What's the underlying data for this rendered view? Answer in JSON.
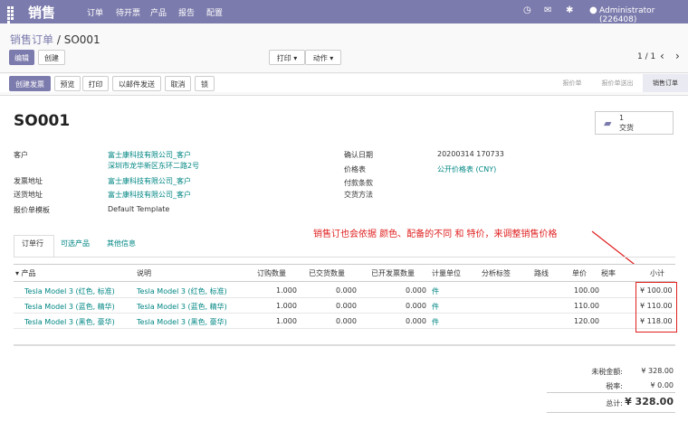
{
  "nav": {
    "app_title": "销售",
    "menu": [
      "订单",
      "待开票",
      "产品",
      "报告",
      "配置"
    ],
    "user": "Administrator (226408)",
    "colors": {
      "bar": "#7c7bad"
    }
  },
  "breadcrumb": {
    "parent": "销售订单",
    "separator": "/",
    "current": "SO001"
  },
  "control": {
    "edit_label": "编辑",
    "create_label": "创建",
    "print_label": "打印 ▾",
    "action_label": "动作 ▾",
    "pager": "1 / 1"
  },
  "statusbar": {
    "buttons": [
      "创建发票",
      "预览",
      "打印",
      "以邮件发送",
      "取消",
      "锁"
    ],
    "stages": [
      "报价单",
      "报价单送出",
      "销售订单"
    ],
    "active_stage": "销售订单"
  },
  "form": {
    "name": "SO001",
    "delivery_count": "1",
    "delivery_label": "交货",
    "left": {
      "customer_label": "客户",
      "customer_name": "富士康科技有限公司_客户",
      "customer_address": "深圳市龙华新区东环二路2号",
      "invoice_addr_label": "发票地址",
      "invoice_addr": "富士康科技有限公司_客户",
      "delivery_addr_label": "送货地址",
      "delivery_addr": "富士康科技有限公司_客户",
      "template_label": "报价单模板",
      "template": "Default Template"
    },
    "right": {
      "confirm_date_label": "确认日期",
      "confirm_date": "20200314 170733",
      "pricelist_label": "价格表",
      "pricelist": "公开价格表 (CNY)",
      "payment_terms_label": "付款条款",
      "delivery_method_label": "交货方法"
    }
  },
  "tabs": [
    "订单行",
    "可选产品",
    "其他信息"
  ],
  "annotation": "销售订也会依据 颜色、配备的不同 和 特价，来调整销售价格",
  "table": {
    "headers": [
      "▾ 产品",
      "说明",
      "订购数量",
      "已交货数量",
      "已开发票数量",
      "计量单位",
      "分析标签",
      "路线",
      "单价",
      "税率",
      "小计"
    ],
    "rows": [
      {
        "product": "Tesla Model 3 (红色, 标准)",
        "desc": "Tesla Model 3 (红色, 标准)",
        "qty": "1.000",
        "delivered": "0.000",
        "invoiced": "0.000",
        "uom": "件",
        "price": "100.00",
        "subtotal": "¥ 100.00"
      },
      {
        "product": "Tesla Model 3 (蓝色, 精华)",
        "desc": "Tesla Model 3 (蓝色, 精华)",
        "qty": "1.000",
        "delivered": "0.000",
        "invoiced": "0.000",
        "uom": "件",
        "price": "110.00",
        "subtotal": "¥ 110.00"
      },
      {
        "product": "Tesla Model 3 (黑色, 豪华)",
        "desc": "Tesla Model 3 (黑色, 豪华)",
        "qty": "1.000",
        "delivered": "0.000",
        "invoiced": "0.000",
        "uom": "件",
        "price": "120.00",
        "subtotal": "¥ 118.00"
      }
    ]
  },
  "totals": {
    "untaxed_label": "未税金额:",
    "untaxed": "¥ 328.00",
    "tax_label": "税率:",
    "tax": "¥ 0.00",
    "total_label": "总计:",
    "total": "¥ 328.00"
  }
}
